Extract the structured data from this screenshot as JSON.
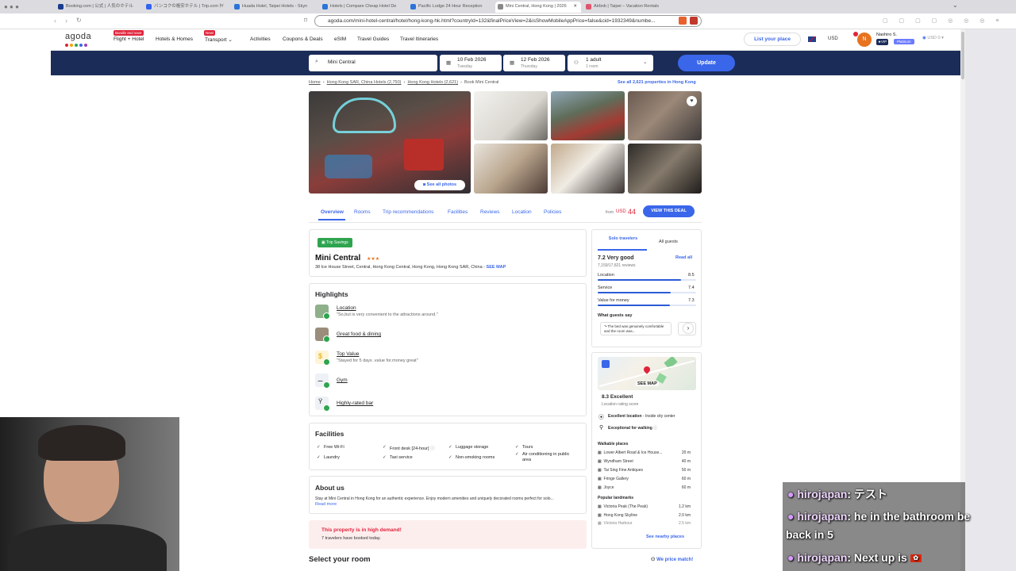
{
  "browser": {
    "tabs": [
      {
        "label": "Booking.com | 公式 | 人気のホテル",
        "color": "#1a3b8e"
      },
      {
        "label": "バンコクの格安ホテル | Trip.com ﾀｲ",
        "color": "#3264f0"
      },
      {
        "label": "Huada Hotel, Taipei Hotels - Skyn",
        "color": "#2b74d8"
      },
      {
        "label": "Hotels | Compare Cheap Hotel De",
        "color": "#2b74d8"
      },
      {
        "label": "Pacific Lodge 24 Hour Reception",
        "color": "#2b74d8"
      },
      {
        "label": "Mini Central, Hong Kong | 2026",
        "color": "#888888"
      },
      {
        "label": "Airbnb | Taipei – Vacation Rentals",
        "color": "#e0566e"
      }
    ],
    "url": "agoda.com/mini-hotel-central/hotel/hong-kong-hk.html?countryId=132&finalPriceView=2&isShowMobileAppPrice=false&cid=1932349&numbe..."
  },
  "header": {
    "logo": "agoda",
    "nav": [
      {
        "label": "Flight + Hotel",
        "badge": "Bundle and save"
      },
      {
        "label": "Hotels & Homes",
        "badge": ""
      },
      {
        "label": "Transport",
        "badge": "New!"
      },
      {
        "label": "Activities",
        "badge": ""
      },
      {
        "label": "Coupons & Deals",
        "badge": ""
      },
      {
        "label": "eSIM",
        "badge": ""
      },
      {
        "label": "Travel Guides",
        "badge": ""
      },
      {
        "label": "Travel Itineraries",
        "badge": ""
      }
    ],
    "list_place": "List your place",
    "currency": "USD",
    "avatar_initial": "N",
    "user_name": "Naohiro S.",
    "vip_label": "★VIP",
    "tier_label": "Platinum",
    "balance": "USD 0"
  },
  "search": {
    "destination": "Mini Central",
    "checkin_date": "10 Feb 2026",
    "checkin_day": "Tuesday",
    "checkout_date": "12 Feb 2026",
    "checkout_day": "Thursday",
    "guests": "1 adult",
    "rooms": "1 room",
    "update_label": "Update"
  },
  "breadcrumb": {
    "home": "Home",
    "c1": "Hong Kong SAR, China Hotels (2,750)",
    "c2": "Hong Kong Hotels (2,621)",
    "c3": "Book Mini Central",
    "see_all": "See all 2,621 properties in Hong Kong"
  },
  "gallery": {
    "see_all": "See all photos"
  },
  "property_tabs": [
    "Overview",
    "Rooms",
    "Trip recommendations",
    "Facilities",
    "Reviews",
    "Location",
    "Policies"
  ],
  "price": {
    "from": "from",
    "currency": "USD",
    "amount": "44",
    "cta": "VIEW THIS DEAL"
  },
  "hotel": {
    "badge": "Trip Savings",
    "name": "Mini Central",
    "stars": "★★★",
    "address": "38 Ice House Street, Central, Hong Kong Central, Hong Kong, Hong Kong SAR, China - ",
    "see_map": "SEE MAP"
  },
  "highlights": {
    "title": "Highlights",
    "items": [
      {
        "title": "Location",
        "sub": "\"So,but is very convenient to the attractions around.\""
      },
      {
        "title": "Great food & dining",
        "sub": ""
      },
      {
        "title": "Top Value",
        "sub": "\"Stayed for 5 days .value for.money great\""
      },
      {
        "title": "Gym",
        "sub": ""
      },
      {
        "title": "Highly-rated bar",
        "sub": ""
      }
    ]
  },
  "facilities": {
    "title": "Facilities",
    "items": [
      "Free Wi-Fi",
      "Front desk [24-hour]",
      "Luggage storage",
      "Tours",
      "Laundry",
      "Taxi service",
      "Non-smoking rooms",
      "Air conditioning in public area"
    ]
  },
  "about": {
    "title": "About us",
    "text": "Stay at Mini Central in Hong Kong for an authentic experience. Enjoy modern amenities and uniquely decorated rooms perfect for solo...",
    "read_more": "Read more"
  },
  "demand": {
    "title": "This property is in high demand!",
    "sub": "7 travelers have booked today."
  },
  "select_room": "Select your room",
  "price_match": "We price match!",
  "reviews": {
    "tab_solo": "Solo travelers",
    "tab_all": "All guests",
    "score": "7.2 Very good",
    "read_all": "Read all",
    "count": "7,159/17,821 reviews",
    "metrics": [
      {
        "label": "Location",
        "value": "8.5",
        "fill": 0.85
      },
      {
        "label": "Service",
        "value": "7.4",
        "fill": 0.74
      },
      {
        "label": "Value for money",
        "value": "7.3",
        "fill": 0.73
      }
    ],
    "guests_say": "What guests say",
    "quote": "\"• The bed was genuinely comfortable and the room was..."
  },
  "location": {
    "see_map": "SEE MAP",
    "score": "8.3 Excellent",
    "score_sub": "Location rating score",
    "excellent": "Excellent location",
    "excellent_sub": " - Inside city center",
    "walking": "Exceptional for walking",
    "walkable_title": "Walkable places",
    "walkable": [
      {
        "name": "Lower Albert Road & Ice House...",
        "dist": "20 m"
      },
      {
        "name": "Wyndham Street",
        "dist": "40 m"
      },
      {
        "name": "Tai Sing Fine Antiques",
        "dist": "50 m"
      },
      {
        "name": "Fringe Gallery",
        "dist": "60 m"
      },
      {
        "name": "Joyce",
        "dist": "60 m"
      }
    ],
    "landmarks_title": "Popular landmarks",
    "landmarks": [
      {
        "name": "Victoria Peak (The Peak)",
        "dist": "1.2 km"
      },
      {
        "name": "Hong Kong Skyline",
        "dist": "2.0 km"
      },
      {
        "name": "Victoria Harbour",
        "dist": "2.5 km"
      }
    ],
    "see_nearby": "See nearby places"
  },
  "chat": [
    {
      "user": "hirojapan",
      "text": ": テスト"
    },
    {
      "user": "hirojapan",
      "text": ": he in the bathroom be"
    },
    {
      "user": "",
      "text": "back in 5"
    },
    {
      "user": "hirojapan",
      "text": ": Next up is"
    }
  ],
  "colors": {
    "brand_blue": "#3a66ea",
    "navy": "#1b2c59",
    "green": "#2ea44f",
    "red": "#e0243b"
  }
}
